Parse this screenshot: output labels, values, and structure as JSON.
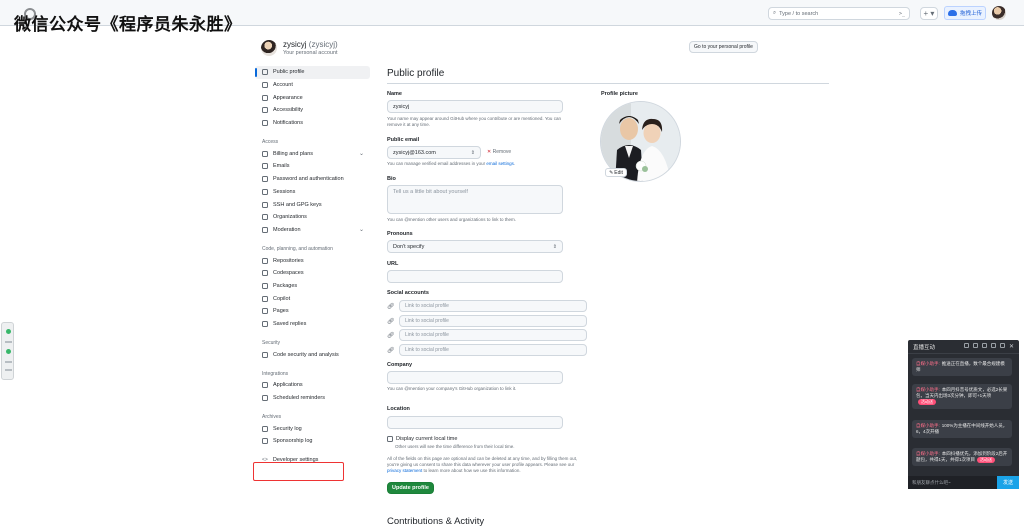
{
  "watermark": {
    "text": "微信公众号《程序员朱永胜》"
  },
  "topbar": {
    "search_placeholder": "Type / to search",
    "command_glyph": ">_",
    "plus_label": "+ ▾",
    "upload_label": "拖拽上传"
  },
  "user": {
    "name": "zysicyj",
    "handle": "(zysicyj)",
    "subtitle": "Your personal account",
    "goto_button": "Go to your personal profile"
  },
  "sidebar": {
    "items_top": [
      {
        "label": "Public profile",
        "icon": "person-icon",
        "active": true
      },
      {
        "label": "Account",
        "icon": "gear-icon"
      },
      {
        "label": "Appearance",
        "icon": "paintbrush-icon"
      },
      {
        "label": "Accessibility",
        "icon": "accessibility-icon"
      },
      {
        "label": "Notifications",
        "icon": "bell-icon"
      }
    ],
    "groups": [
      {
        "title": "Access",
        "items": [
          {
            "label": "Billing and plans",
            "icon": "credit-card-icon",
            "chevron": true
          },
          {
            "label": "Emails",
            "icon": "mail-icon"
          },
          {
            "label": "Password and authentication",
            "icon": "shield-lock-icon"
          },
          {
            "label": "Sessions",
            "icon": "broadcast-icon"
          },
          {
            "label": "SSH and GPG keys",
            "icon": "key-icon"
          },
          {
            "label": "Organizations",
            "icon": "organization-icon"
          },
          {
            "label": "Moderation",
            "icon": "report-icon",
            "chevron": true
          }
        ]
      },
      {
        "title": "Code, planning, and automation",
        "items": [
          {
            "label": "Repositories",
            "icon": "repo-icon"
          },
          {
            "label": "Codespaces",
            "icon": "codespaces-icon"
          },
          {
            "label": "Packages",
            "icon": "package-icon"
          },
          {
            "label": "Copilot",
            "icon": "copilot-icon"
          },
          {
            "label": "Pages",
            "icon": "browser-icon"
          },
          {
            "label": "Saved replies",
            "icon": "reply-icon"
          }
        ]
      },
      {
        "title": "Security",
        "items": [
          {
            "label": "Code security and analysis",
            "icon": "codescan-icon"
          }
        ]
      },
      {
        "title": "Integrations",
        "items": [
          {
            "label": "Applications",
            "icon": "apps-icon"
          },
          {
            "label": "Scheduled reminders",
            "icon": "clock-icon"
          }
        ]
      },
      {
        "title": "Archives",
        "items": [
          {
            "label": "Security log",
            "icon": "log-icon"
          },
          {
            "label": "Sponsorship log",
            "icon": "heart-log-icon"
          }
        ]
      }
    ],
    "developer_settings": "Developer settings"
  },
  "profile": {
    "heading": "Public profile",
    "name_label": "Name",
    "name_value": "zysicyj",
    "name_note": "Your name may appear around GitHub where you contribute or are mentioned. You can remove it at any time.",
    "email_label": "Public email",
    "email_value": "zysicyj@163.com",
    "email_remove": "Remove",
    "email_note_prefix": "You can manage verified email addresses in your ",
    "email_note_link": "email settings",
    "email_note_suffix": ".",
    "bio_label": "Bio",
    "bio_placeholder": "Tell us a little bit about yourself",
    "bio_note": "You can @mention other users and organizations to link to them.",
    "pronouns_label": "Pronouns",
    "pronouns_value": "Don't specify",
    "url_label": "URL",
    "social_label": "Social accounts",
    "social_placeholder": "Link to social profile",
    "company_label": "Company",
    "company_note": "You can @mention your company's GitHub organization to link it.",
    "location_label": "Location",
    "local_time_label": "Display current local time",
    "local_time_note": "Other users will see the time difference from their local time.",
    "footer_note": "All of the fields on this page are optional and can be deleted at any time, and by filling them out, you're giving us consent to share this data wherever your user profile appears. Please see our ",
    "footer_link": "privacy statement",
    "footer_suffix": " to learn more about how we use this information.",
    "update_button": "Update profile",
    "contributions_heading": "Contributions & Activity",
    "picture_label": "Profile picture",
    "edit_button": "Edit"
  },
  "live_panel": {
    "title": "直播互动",
    "messages": [
      {
        "who": "自媒小助手:",
        "text": "推送正在直播，数个最合规建模师",
        "tag": ""
      },
      {
        "who": "自媒小助手:",
        "text": "本四月抖音号优质文，必选2长果包，当天内出场3次分钟，即可+1天项",
        "tag": "活动送"
      },
      {
        "who": "自媒小助手:",
        "text": "100%为主播在中间线开始人员，6，4次开播",
        "tag": ""
      },
      {
        "who": "自媒小助手:",
        "text": "本四抖播优先，添加到阶段2后开题包，共得1天，共得1次项目",
        "tag": "活动送"
      }
    ],
    "input_placeholder": "和朋友聊点什么吧~",
    "send_button": "发送"
  }
}
